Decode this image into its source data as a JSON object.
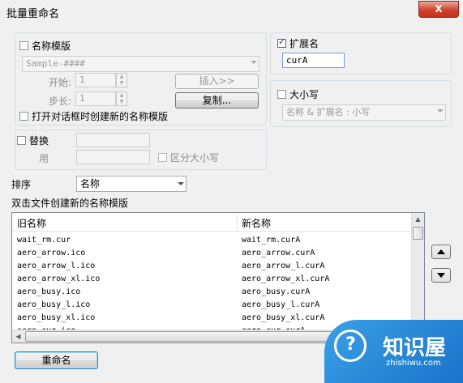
{
  "window": {
    "title": "批量重命名",
    "close_glyph": "X"
  },
  "name_template": {
    "checkbox_label": "名称模版",
    "checked": false,
    "template_value": "Sample-####",
    "start_label": "开始:",
    "start_value": "1",
    "step_label": "步长:",
    "step_value": "1",
    "insert_button": "插入>>",
    "copy_button": "复制...",
    "open_dialog_label": "打开对话框时创建新的名称模版"
  },
  "extension": {
    "checkbox_label": "扩展名",
    "checked": true,
    "value": "curA"
  },
  "case": {
    "checkbox_label": "大小写",
    "checked": false,
    "select_value": "名称 & 扩展名 : 小写"
  },
  "replace": {
    "checkbox_label": "替换",
    "checked": false,
    "with_label": "用",
    "case_sensitive_label": "区分大小写"
  },
  "sort": {
    "label": "排序",
    "value": "名称"
  },
  "list": {
    "caption": "双击文件创建新的名称模版",
    "columns": [
      "旧名称",
      "新名称"
    ],
    "rows": [
      {
        "old": "wait_rm.cur",
        "new": "wait_rm.curA"
      },
      {
        "old": "aero_arrow.ico",
        "new": "aero_arrow.curA"
      },
      {
        "old": "aero_arrow_l.ico",
        "new": "aero_arrow_l.curA"
      },
      {
        "old": "aero_arrow_xl.ico",
        "new": "aero_arrow_xl.curA"
      },
      {
        "old": "aero_busy.ico",
        "new": "aero_busy.curA"
      },
      {
        "old": "aero_busy_l.ico",
        "new": "aero_busy_l.curA"
      },
      {
        "old": "aero_busy_xl.ico",
        "new": "aero_busy_xl.curA"
      },
      {
        "old": "aero_cur.ico",
        "new": "aero_cur.curA"
      }
    ]
  },
  "rename_button": "重命名",
  "watermark": {
    "text": "知识屋",
    "url": "zhishiwu.com"
  }
}
